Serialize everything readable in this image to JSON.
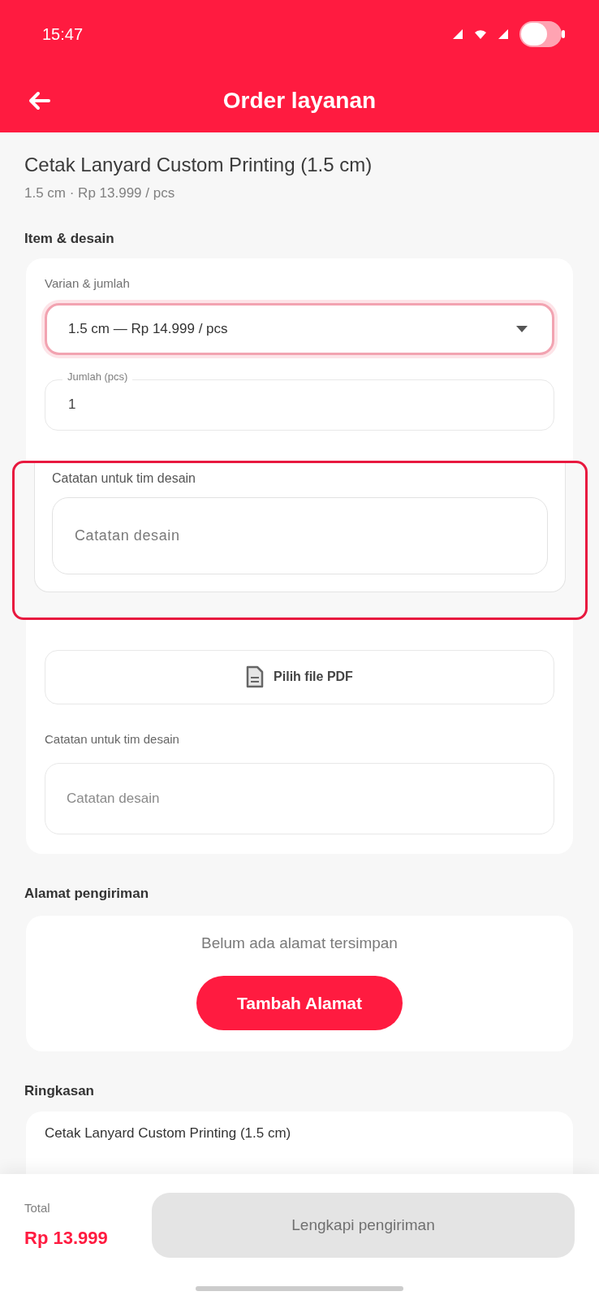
{
  "status_bar": {
    "time": "15:47"
  },
  "header": {
    "title": "Order layanan"
  },
  "product": {
    "title": "Cetak Lanyard Custom Printing (1.5 cm)",
    "subtitle": "1.5 cm · Rp 13.999 / pcs"
  },
  "item_section": {
    "heading": "Item & desain",
    "variant_label": "Varian & jumlah",
    "variant_value": "1.5 cm — Rp 14.999 / pcs",
    "variant_focused": true,
    "quantity_label": "Jumlah (pcs)",
    "quantity_value": "1",
    "upload_button": "Pilih file PDF",
    "notes_label": "Catatan untuk tim desain",
    "notes_placeholder": "Catatan desain"
  },
  "highlight": {
    "label": "Catatan untuk tim desain",
    "placeholder": "Catatan desain"
  },
  "address_section": {
    "heading": "Alamat pengiriman",
    "empty_text": "Belum ada alamat tersimpan",
    "add_button": "Tambah Alamat"
  },
  "summary_section": {
    "heading": "Ringkasan",
    "item": "Cetak Lanyard Custom Printing (1.5 cm)"
  },
  "footer": {
    "total_label": "Total",
    "total_value": "Rp 13.999",
    "submit_button": "Lengkapi pengiriman",
    "submit_disabled": true
  }
}
